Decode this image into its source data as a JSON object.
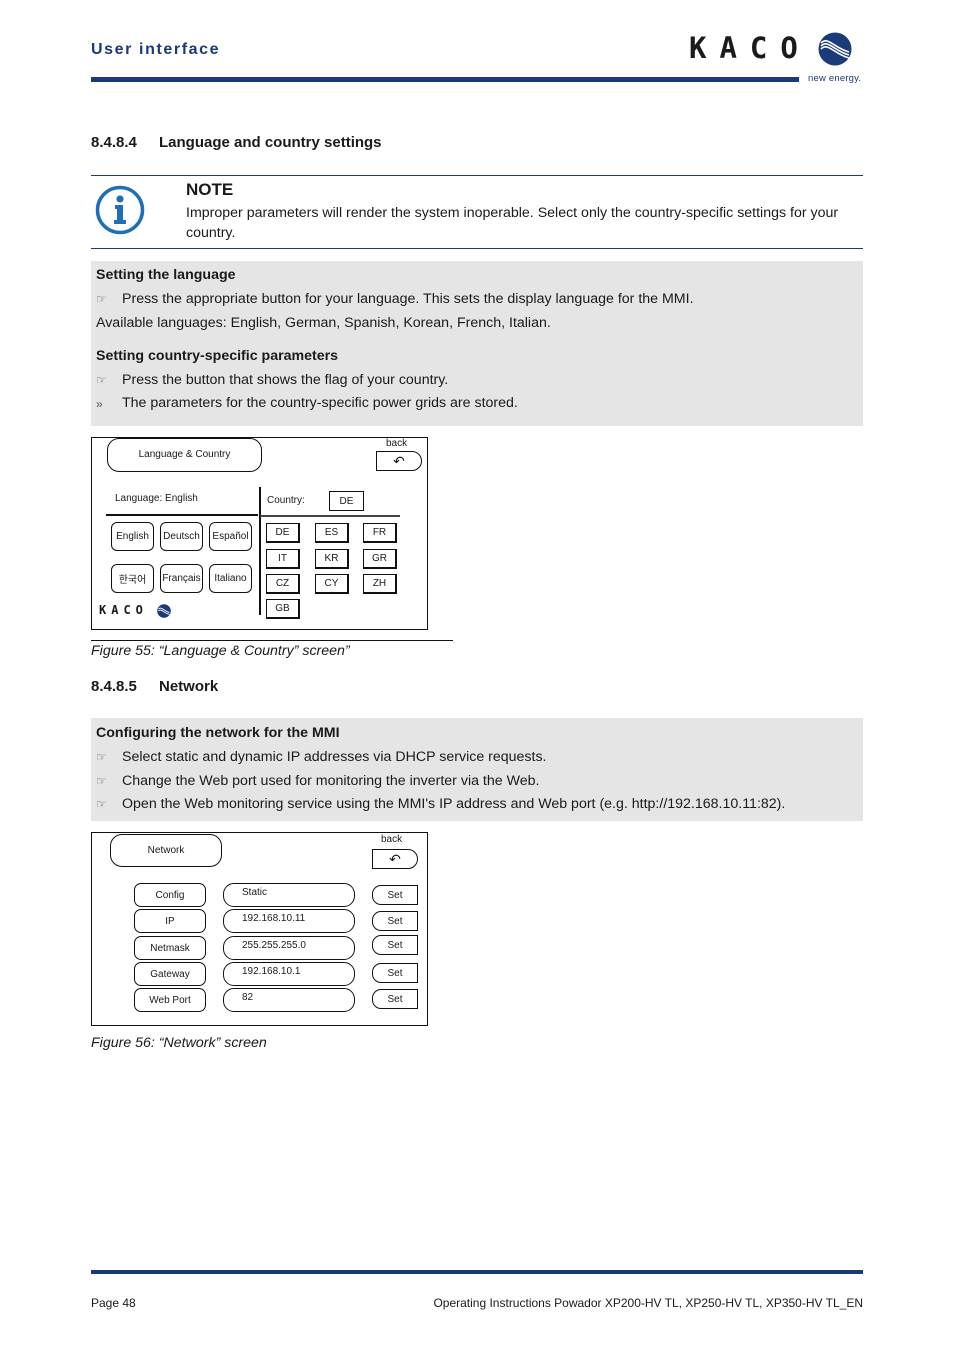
{
  "header": {
    "section_title": "User interface",
    "logo_text": "KACO",
    "logo_tagline": "new energy."
  },
  "section_lang": {
    "number": "8.4.8.4",
    "title": "Language and country settings"
  },
  "note": {
    "icon": "info-icon",
    "title": "NOTE",
    "text": "Improper parameters will render the system inoperable. Select only the country-specific settings for your country."
  },
  "lang_box": {
    "title1": "Setting the language",
    "step1": "Press the appropriate button for your language. This sets the display language for the MMI.",
    "available": "Available languages: English, German, Spanish, Korean, French, Italian.",
    "title2": "Setting country-specific parameters",
    "step2": "Press the button that shows the flag of your country.",
    "result": "The parameters for the country-specific power grids are stored.",
    "step_symbol": "☞",
    "result_symbol": "»"
  },
  "lang_screen": {
    "title": "Language & Country",
    "back_label": "back",
    "back_icon": "↶",
    "language_label": "Language:  English",
    "country_label": "Country:",
    "country_value": "DE",
    "languages": [
      "English",
      "Deutsch",
      "Español",
      "한국어",
      "Français",
      "Italiano"
    ],
    "countries": [
      "DE",
      "ES",
      "FR",
      "IT",
      "KR",
      "GR",
      "CZ",
      "CY",
      "ZH",
      "GB"
    ],
    "logo_text": "KACO"
  },
  "fig55_caption": "Figure 55: “Language & Country” screen”",
  "section_net": {
    "number": "8.4.8.5",
    "title": "Network"
  },
  "net_box": {
    "title": "Configuring the network for the MMI",
    "steps": [
      "Select static and dynamic IP addresses via DHCP service requests.",
      "Change the Web port used for monitoring the inverter via the Web.",
      "Open the Web monitoring service using the MMI's IP address and Web port (e.g. http://192.168.10.11:82)."
    ]
  },
  "net_screen": {
    "title": "Network",
    "back_label": "back",
    "back_icon": "↶",
    "rows": [
      {
        "label": "Config",
        "value": "Static",
        "button": "Set"
      },
      {
        "label": "IP",
        "value": "192.168.10.11",
        "button": "Set"
      },
      {
        "label": "Netmask",
        "value": "255.255.255.0",
        "button": "Set"
      },
      {
        "label": "Gateway",
        "value": "192.168.10.1",
        "button": "Set"
      },
      {
        "label": "Web Port",
        "value": "82",
        "button": "Set"
      }
    ]
  },
  "fig56_caption": "Figure 56: “Network” screen",
  "footer": {
    "page": "Page 48",
    "doc_title": "Operating Instructions Powador XP200-HV TL, XP250-HV TL, XP350-HV TL_EN"
  },
  "colors": {
    "brand_blue": "#1b3a7a",
    "info_blue": "#1e6fb8",
    "box_grey": "#e5e5e5"
  }
}
